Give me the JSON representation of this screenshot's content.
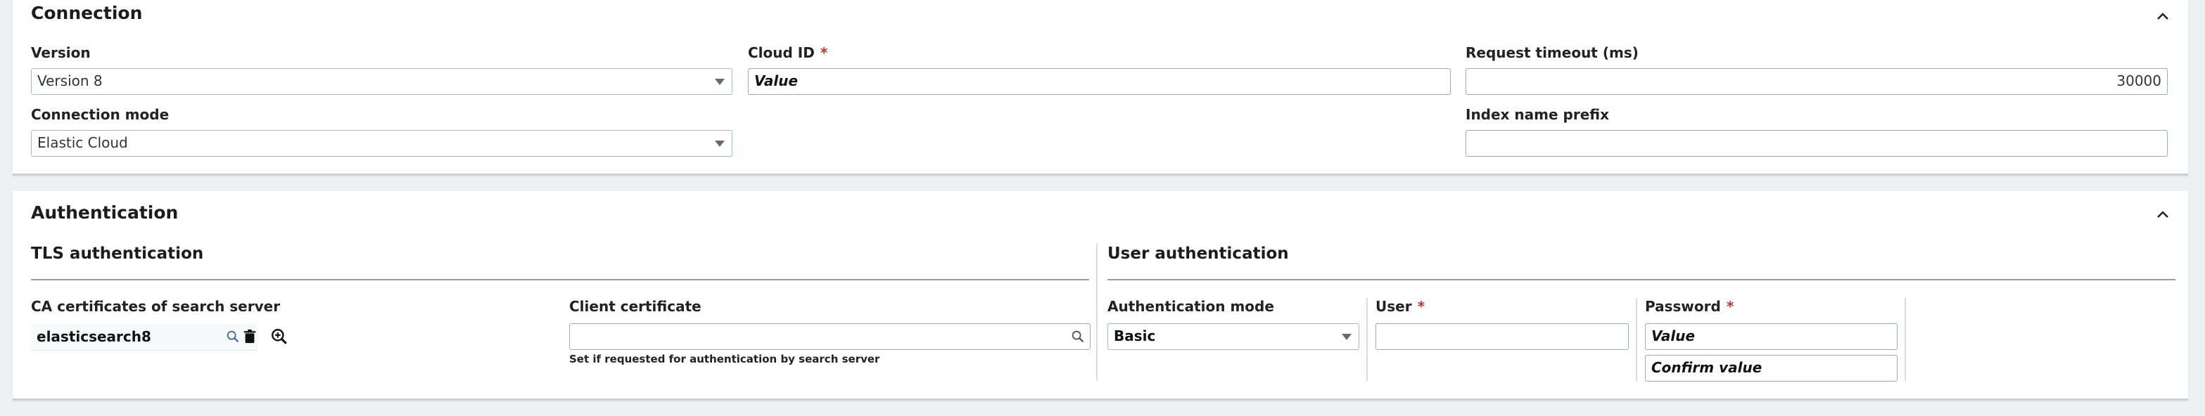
{
  "connection": {
    "title": "Connection",
    "version": {
      "label": "Version",
      "value": "Version 8"
    },
    "cloud_id": {
      "label": "Cloud ID",
      "required_mark": "*",
      "value": "Value"
    },
    "request_timeout": {
      "label": "Request timeout (ms)",
      "value": "30000"
    },
    "connection_mode": {
      "label": "Connection mode",
      "value": "Elastic Cloud"
    },
    "index_prefix": {
      "label": "Index name prefix",
      "value": ""
    }
  },
  "authentication": {
    "title": "Authentication",
    "tls": {
      "title": "TLS authentication",
      "ca_certs": {
        "label": "CA certificates of search server",
        "value": "elasticsearch8"
      },
      "client_cert": {
        "label": "Client certificate",
        "value": "",
        "help": "Set if requested for authentication by search server"
      }
    },
    "user_auth": {
      "title": "User authentication",
      "mode": {
        "label": "Authentication mode",
        "value": "Basic"
      },
      "user": {
        "label": "User",
        "required_mark": "*",
        "value": ""
      },
      "password": {
        "label": "Password",
        "required_mark": "*",
        "value": "Value",
        "confirm": "Confirm value"
      }
    }
  },
  "colors": {
    "background": "#eef1f4",
    "panel": "#ffffff",
    "required": "#cc2f2f",
    "field_border": "#9aaab6"
  },
  "icons": [
    "chevron-up-icon",
    "dropdown-arrow-icon",
    "search-icon",
    "trash-icon",
    "zoom-in-icon"
  ]
}
